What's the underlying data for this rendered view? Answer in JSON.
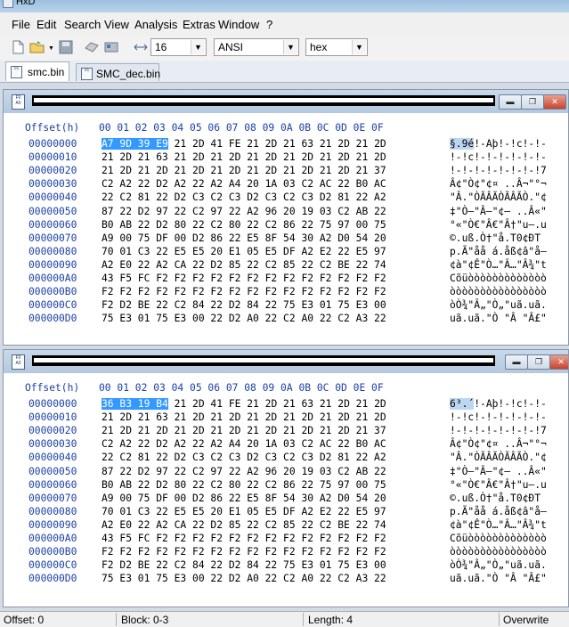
{
  "window": {
    "title": "HxD"
  },
  "menu": [
    "File",
    "Edit",
    "Search",
    "View",
    "Analysis",
    "Extras",
    "Window",
    "?"
  ],
  "toolbar": {
    "bytes_per_row": "16",
    "charset": "ANSI",
    "offset_base": "hex"
  },
  "tabs": [
    {
      "label": "smc.bin"
    },
    {
      "label": "SMC_dec.bin"
    }
  ],
  "hex_header": {
    "offset_label": "Offset(h)",
    "columns": "00 01 02 03 04 05 06 07 08 09 0A 0B 0C 0D 0E 0F"
  },
  "editor1": {
    "rows": [
      {
        "offset": "00000000",
        "sel": "A7 9D 39 E9",
        "hex": " 21 2D 41 FE 21 2D 21 63 21 2D 21 2D",
        "ascii_sel": "§.9é",
        "ascii": "!-Aþ!-!c!-!-"
      },
      {
        "offset": "00000010",
        "hex": "21 2D 21 63 21 2D 21 2D 21 2D 21 2D 21 2D 21 2D",
        "ascii": "!-!c!-!-!-!-!-!-"
      },
      {
        "offset": "00000020",
        "hex": "21 2D 21 2D 21 2D 21 2D 21 2D 21 2D 21 2D 21 37",
        "ascii": "!-!-!-!-!-!-!-!7"
      },
      {
        "offset": "00000030",
        "hex": "C2 A2 22 D2 A2 22 A2 A4 20 1A 03 C2 AC 22 B0 AC",
        "ascii": "Â¢\"Ò¢\"¢¤ ..Â¬\"°¬"
      },
      {
        "offset": "00000040",
        "hex": "22 C2 81 22 D2 C3 C2 C3 D2 C3 C2 C3 D2 81 22 A2",
        "ascii": "\"Â.\"ÒÃÂÃÒÃÂÃÒ.\"¢"
      },
      {
        "offset": "00000050",
        "hex": "87 22 D2 97 22 C2 97 22 A2 96 20 19 03 C2 AB 22",
        "ascii": "‡\"Ò—\"Â—\"¢– ..Â«\""
      },
      {
        "offset": "00000060",
        "hex": "B0 AB 22 D2 80 22 C2 80 22 C2 86 22 75 97 00 75",
        "ascii": "°«\"Ò€\"Â€\"Â†\"u—.u"
      },
      {
        "offset": "00000070",
        "hex": "A9 00 75 DF 00 D2 86 22 E5 8F 54 30 A2 D0 54 20",
        "ascii": "©.uß.Ò†\"å.T0¢ÐT "
      },
      {
        "offset": "00000080",
        "hex": "70 01 C3 22 E5 E5 20 E1 05 E5 DF A2 E2 22 E5 97",
        "ascii": "p.Ã\"åå á.åß¢â\"å—"
      },
      {
        "offset": "00000090",
        "hex": "A2 E0 22 A2 CA 22 D2 85 22 C2 85 22 C2 BE 22 74",
        "ascii": "¢à\"¢Ê\"Ò…\"Â…\"Â¾\"t"
      },
      {
        "offset": "000000A0",
        "hex": "43 F5 FC F2 F2 F2 F2 F2 F2 F2 F2 F2 F2 F2 F2 F2",
        "ascii": "Cõüòòòòòòòòòòòòò"
      },
      {
        "offset": "000000B0",
        "hex": "F2 F2 F2 F2 F2 F2 F2 F2 F2 F2 F2 F2 F2 F2 F2 F2",
        "ascii": "òòòòòòòòòòòòòòòò"
      },
      {
        "offset": "000000C0",
        "hex": "F2 D2 BE 22 C2 84 22 D2 84 22 75 E3 01 75 E3 00",
        "ascii": "òÒ¾\"Â„\"Ò„\"uã.uã."
      },
      {
        "offset": "000000D0",
        "hex": "75 E3 01 75 E3 00 22 D2 A0 22 C2 A0 22 C2 A3 22",
        "ascii": "uã.uã.\"Ò \"Â \"Â£\""
      }
    ]
  },
  "editor2": {
    "rows": [
      {
        "offset": "00000000",
        "sel": "36 B3 19 B4",
        "hex": " 21 2D 41 FE 21 2D 21 63 21 2D 21 2D",
        "ascii_sel": "6³.´",
        "ascii": "!-Aþ!-!c!-!-"
      },
      {
        "offset": "00000010",
        "hex": "21 2D 21 63 21 2D 21 2D 21 2D 21 2D 21 2D 21 2D",
        "ascii": "!-!c!-!-!-!-!-!-"
      },
      {
        "offset": "00000020",
        "hex": "21 2D 21 2D 21 2D 21 2D 21 2D 21 2D 21 2D 21 37",
        "ascii": "!-!-!-!-!-!-!-!7"
      },
      {
        "offset": "00000030",
        "hex": "C2 A2 22 D2 A2 22 A2 A4 20 1A 03 C2 AC 22 B0 AC",
        "ascii": "Â¢\"Ò¢\"¢¤ ..Â¬\"°¬"
      },
      {
        "offset": "00000040",
        "hex": "22 C2 81 22 D2 C3 C2 C3 D2 C3 C2 C3 D2 81 22 A2",
        "ascii": "\"Â.\"ÒÃÂÃÒÃÂÃÒ.\"¢"
      },
      {
        "offset": "00000050",
        "hex": "87 22 D2 97 22 C2 97 22 A2 96 20 19 03 C2 AB 22",
        "ascii": "‡\"Ò—\"Â—\"¢– ..Â«\""
      },
      {
        "offset": "00000060",
        "hex": "B0 AB 22 D2 80 22 C2 80 22 C2 86 22 75 97 00 75",
        "ascii": "°«\"Ò€\"Â€\"Â†\"u—.u"
      },
      {
        "offset": "00000070",
        "hex": "A9 00 75 DF 00 D2 86 22 E5 8F 54 30 A2 D0 54 20",
        "ascii": "©.uß.Ò†\"å.T0¢ÐT "
      },
      {
        "offset": "00000080",
        "hex": "70 01 C3 22 E5 E5 20 E1 05 E5 DF A2 E2 22 E5 97",
        "ascii": "p.Ã\"åå á.åß¢â\"å—"
      },
      {
        "offset": "00000090",
        "hex": "A2 E0 22 A2 CA 22 D2 85 22 C2 85 22 C2 BE 22 74",
        "ascii": "¢à\"¢Ê\"Ò…\"Â…\"Â¾\"t"
      },
      {
        "offset": "000000A0",
        "hex": "43 F5 FC F2 F2 F2 F2 F2 F2 F2 F2 F2 F2 F2 F2 F2",
        "ascii": "Cõüòòòòòòòòòòòòò"
      },
      {
        "offset": "000000B0",
        "hex": "F2 F2 F2 F2 F2 F2 F2 F2 F2 F2 F2 F2 F2 F2 F2 F2",
        "ascii": "òòòòòòòòòòòòòòòò"
      },
      {
        "offset": "000000C0",
        "hex": "F2 D2 BE 22 C2 84 22 D2 84 22 75 E3 01 75 E3 00",
        "ascii": "òÒ¾\"Â„\"Ò„\"uã.uã."
      },
      {
        "offset": "000000D0",
        "hex": "75 E3 01 75 E3 00 22 D2 A0 22 C2 A0 22 C2 A3 22",
        "ascii": "uã.uã.\"Ò \"Â \"Â£\""
      }
    ]
  },
  "status": {
    "offset": "Offset: 0",
    "block": "Block: 0-3",
    "length": "Length: 4",
    "mode": "Overwrite"
  }
}
